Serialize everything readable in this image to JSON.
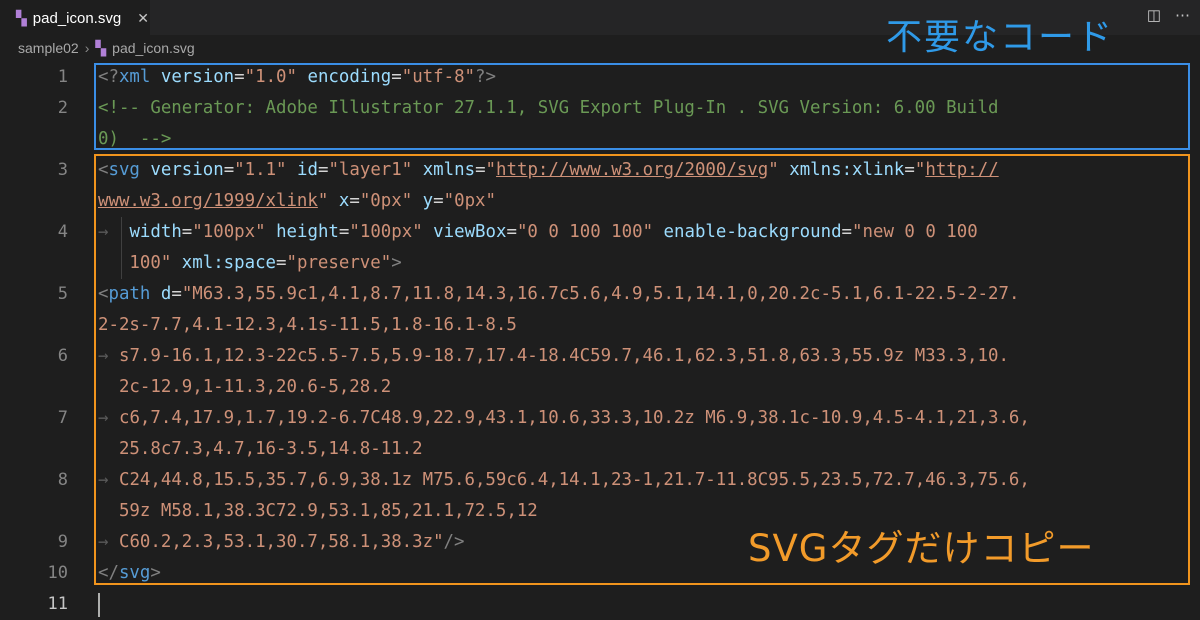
{
  "tab": {
    "filename": "pad_icon.svg",
    "close_glyph": "✕"
  },
  "editor_actions": {
    "split": "◫",
    "more": "⋯"
  },
  "breadcrumb": {
    "folder": "sample02",
    "separator": "›",
    "file": "pad_icon.svg"
  },
  "gutter": [
    "1",
    "2",
    "3",
    "4",
    "5",
    "6",
    "7",
    "8",
    "9",
    "10",
    "11"
  ],
  "code": {
    "l1": {
      "open": "<?",
      "tag": "xml",
      "a1": "version",
      "eq1": "=",
      "v1": "\"1.0\"",
      "a2": "encoding",
      "eq2": "=",
      "v2": "\"utf-8\"",
      "close": "?>"
    },
    "l2a": "<!-- Generator: Adobe Illustrator 27.1.1, SVG Export Plug-In . SVG Version: 6.00 Build",
    "l2b": "0)  -->",
    "l3a": {
      "lt": "<",
      "tag": "svg",
      "a1": "version",
      "v1": "\"1.1\"",
      "a2": "id",
      "v2": "\"layer1\"",
      "a3": "xmlns",
      "v3q": "\"",
      "v3url": "http://www.w3.org/2000/svg",
      "v3q2": "\"",
      "a4": "xmlns:xlink",
      "v4q": "\"",
      "v4url": "http://"
    },
    "l3b": {
      "url": "www.w3.org/1999/xlink",
      "q": "\"",
      "a1": "x",
      "v1": "\"0px\"",
      "a2": "y",
      "v2": "\"0px\""
    },
    "l4a": {
      "arrow": "→",
      "a1": "width",
      "v1": "\"100px\"",
      "a2": "height",
      "v2": "\"100px\"",
      "a3": "viewBox",
      "v3": "\"0 0 100 100\"",
      "a4": "enable-background",
      "v4": "\"new 0 0 100"
    },
    "l4b": {
      "v4b": "100\"",
      "a5": "xml:space",
      "v5": "\"preserve\"",
      "gt": ">"
    },
    "l5a": {
      "lt": "<",
      "tag": "path",
      "a1": "d",
      "v1": "\"M63.3,55.9c1,4.1,8.7,11.8,14.3,16.7c5.6,4.9,5.1,14.1,0,20.2c-5.1,6.1-22.5-2-27."
    },
    "l5b": "2-2s-7.7,4.1-12.3,4.1s-11.5,1.8-16.1-8.5",
    "l6a": "s7.9-16.1,12.3-22c5.5-7.5,5.9-18.7,17.4-18.4C59.7,46.1,62.3,51.8,63.3,55.9z M33.3,10.",
    "l6b": "2c-12.9,1-11.3,20.6-5,28.2",
    "l7a": "c6,7.4,17.9,1.7,19.2-6.7C48.9,22.9,43.1,10.6,33.3,10.2z M6.9,38.1c-10.9,4.5-4.1,21,3.6,",
    "l7b": "25.8c7.3,4.7,16-3.5,14.8-11.2",
    "l8a": "C24,44.8,15.5,35.7,6.9,38.1z M75.6,59c6.4,14.1,23-1,21.7-11.8C95.5,23.5,72.7,46.3,75.6,",
    "l8b": "59z M58.1,38.3C72.9,53.1,85,21.1,72.5,12",
    "l9": {
      "text": "C60.2,2.3,53.1,30.7,58.1,38.3z\"",
      "end": "/>"
    },
    "l10": {
      "open": "</",
      "tag": "svg",
      "close": ">"
    }
  },
  "annotations": {
    "blue": "不要なコード",
    "orange": "SVGタグだけコピー",
    "blue_color": "#3a8ee6",
    "orange_color": "#f0941d"
  }
}
